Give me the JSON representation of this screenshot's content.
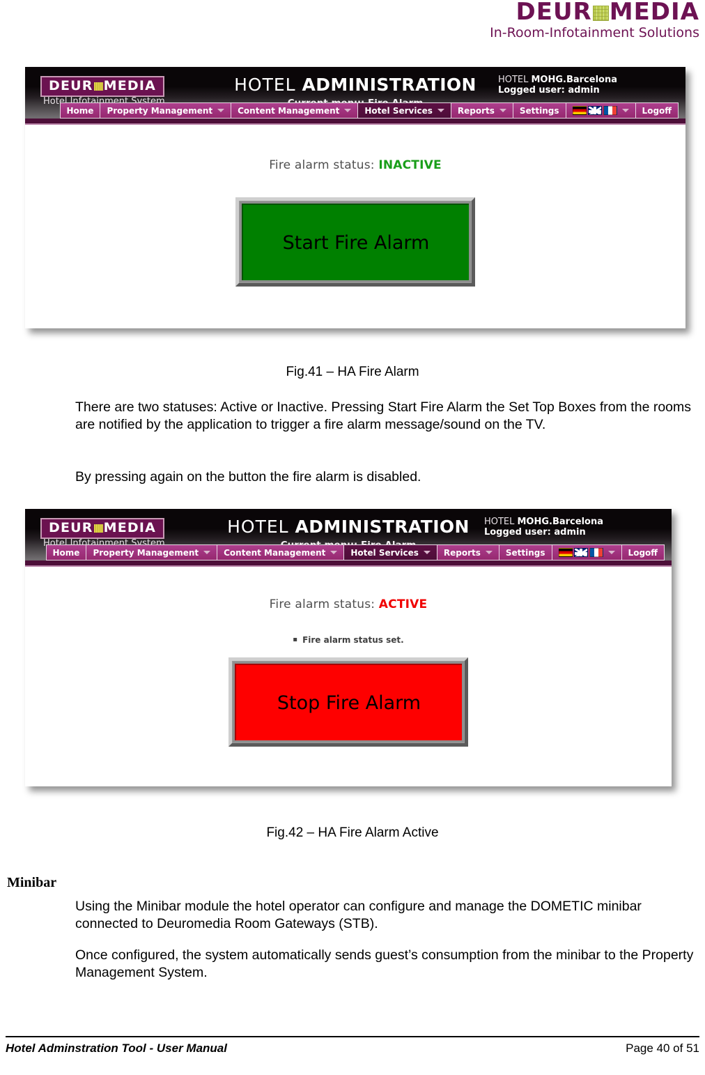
{
  "brand": {
    "logo_text_before": "DEUR",
    "logo_text_after": "MEDIA",
    "tagline": "In-Room-Infotainment Solutions",
    "accent_color": "#6d1253",
    "grid_color": "#c3d45a"
  },
  "app": {
    "logo_before": "DEUR",
    "logo_after": "MEDIA",
    "logo_subtitle": "Hotel Infotainment System",
    "title_thin": "HOTEL ",
    "title_bold": "ADMINISTRATION",
    "current_menu_label": "Current menu: ",
    "current_menu_value": "Fire Alarm",
    "hotel_label": "HOTEL ",
    "hotel_name": "MOHG.Barcelona",
    "user_label": "Logged user: ",
    "user_name": "admin",
    "nav": [
      {
        "label": "Home",
        "has_caret": false,
        "active": false
      },
      {
        "label": "Property Management",
        "has_caret": true,
        "active": false
      },
      {
        "label": "Content Management",
        "has_caret": true,
        "active": false
      },
      {
        "label": "Hotel Services",
        "has_caret": true,
        "active": true
      },
      {
        "label": "Reports",
        "has_caret": true,
        "active": false
      },
      {
        "label": "Settings",
        "has_caret": false,
        "active": false
      },
      {
        "label": "",
        "has_caret": true,
        "active": false,
        "flags": [
          "de",
          "uk",
          "fr"
        ]
      },
      {
        "label": "Logoff",
        "has_caret": false,
        "active": false
      }
    ]
  },
  "screen_inactive": {
    "status_label": "Fire alarm status: ",
    "status_value": "INACTIVE",
    "status_color": "#1a9e1a",
    "button_label": "Start Fire Alarm",
    "button_color": "#008000"
  },
  "screen_active": {
    "status_label": "Fire alarm status: ",
    "status_value": "ACTIVE",
    "status_color": "#f00000",
    "message": "Fire alarm status set.",
    "button_label": "Stop Fire Alarm",
    "button_color": "#fe0000"
  },
  "document": {
    "caption_1": "Fig.41 – HA Fire Alarm",
    "caption_2": "Fig.42 – HA Fire Alarm Active",
    "para_1": "There are two statuses: Active or Inactive. Pressing Start Fire Alarm the Set Top Boxes from the rooms are notified by the application to trigger a fire alarm message/sound on the TV.",
    "para_2": "By pressing again on the button the fire alarm is disabled.",
    "section_heading": "Minibar",
    "para_3": "Using the Minibar module the hotel operator can configure and manage the DOMETIC minibar connected to Deuromedia Room Gateways (STB).",
    "para_4": "Once configured, the system automatically sends guest’s consumption from the minibar to the Property Management System."
  },
  "footer": {
    "left": "Hotel Adminstration Tool - User Manual",
    "right": "Page 40 of 51"
  }
}
